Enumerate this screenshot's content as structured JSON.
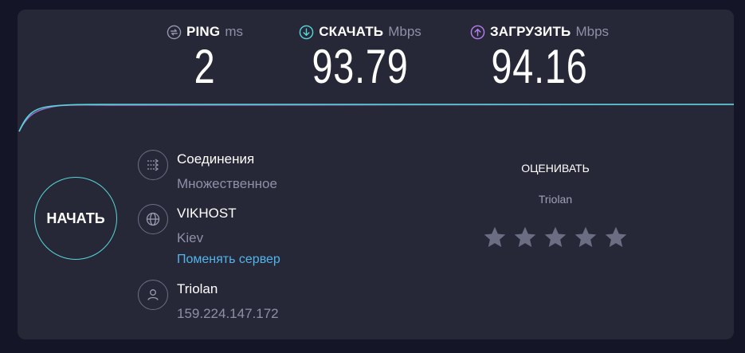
{
  "metrics": {
    "ping": {
      "name": "PING",
      "unit": "ms",
      "value": "2",
      "icon": "ping-icon"
    },
    "download": {
      "name": "СКАЧАТЬ",
      "unit": "Mbps",
      "value": "93.79",
      "icon": "download-arrow-icon",
      "color": "#56d6d8"
    },
    "upload": {
      "name": "ЗАГРУЗИТЬ",
      "unit": "Mbps",
      "value": "94.16",
      "icon": "upload-arrow-icon",
      "color": "#b57ff0"
    }
  },
  "start_button": {
    "label": "НАЧАТЬ"
  },
  "connections": {
    "title": "Соединения",
    "mode": "Множественное",
    "icon": "connections-icon"
  },
  "server": {
    "name": "VIKHOST",
    "city": "Kiev",
    "change_link": "Поменять сервер",
    "icon": "globe-icon"
  },
  "client": {
    "isp": "Triolan",
    "ip": "159.224.147.172",
    "icon": "user-icon"
  },
  "rating": {
    "title": "ОЦЕНИВАТЬ",
    "isp": "Triolan",
    "stars_total": 5,
    "stars_selected": 0
  },
  "colors": {
    "background": "#141526",
    "panel": "#262838",
    "accent": "#56d6d8",
    "link": "#53b4ea",
    "upload": "#b57ff0"
  }
}
